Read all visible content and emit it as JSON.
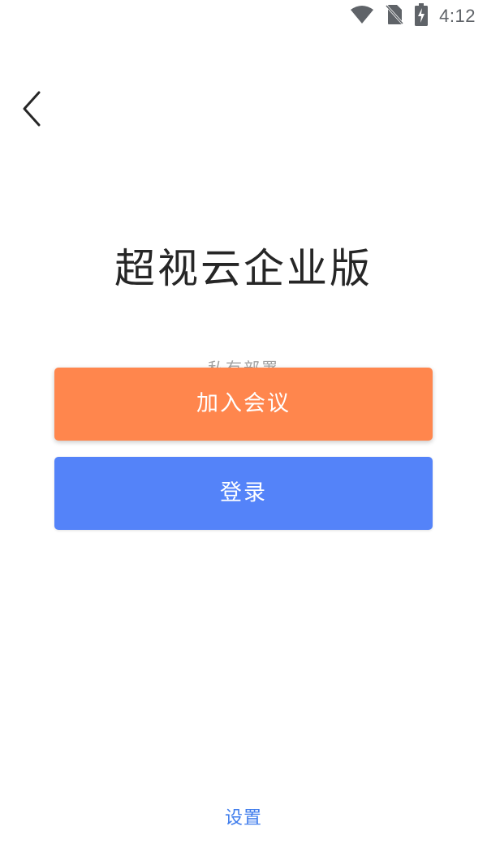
{
  "status_bar": {
    "time": "4:12",
    "icons": [
      "wifi-icon",
      "no-sim-icon",
      "battery-charging-icon"
    ],
    "icon_color": "#5f6368"
  },
  "header": {
    "back_icon": "chevron-left-icon"
  },
  "main": {
    "title": "超视云企业版",
    "deployment_label": "私有部署",
    "join_meeting_label": "加入会议",
    "login_label": "登录"
  },
  "footer": {
    "settings_label": "设置"
  },
  "colors": {
    "join_button": "#ff864d",
    "login_button": "#5483f9",
    "settings_link": "#3f7cec",
    "title_text": "#262626"
  }
}
